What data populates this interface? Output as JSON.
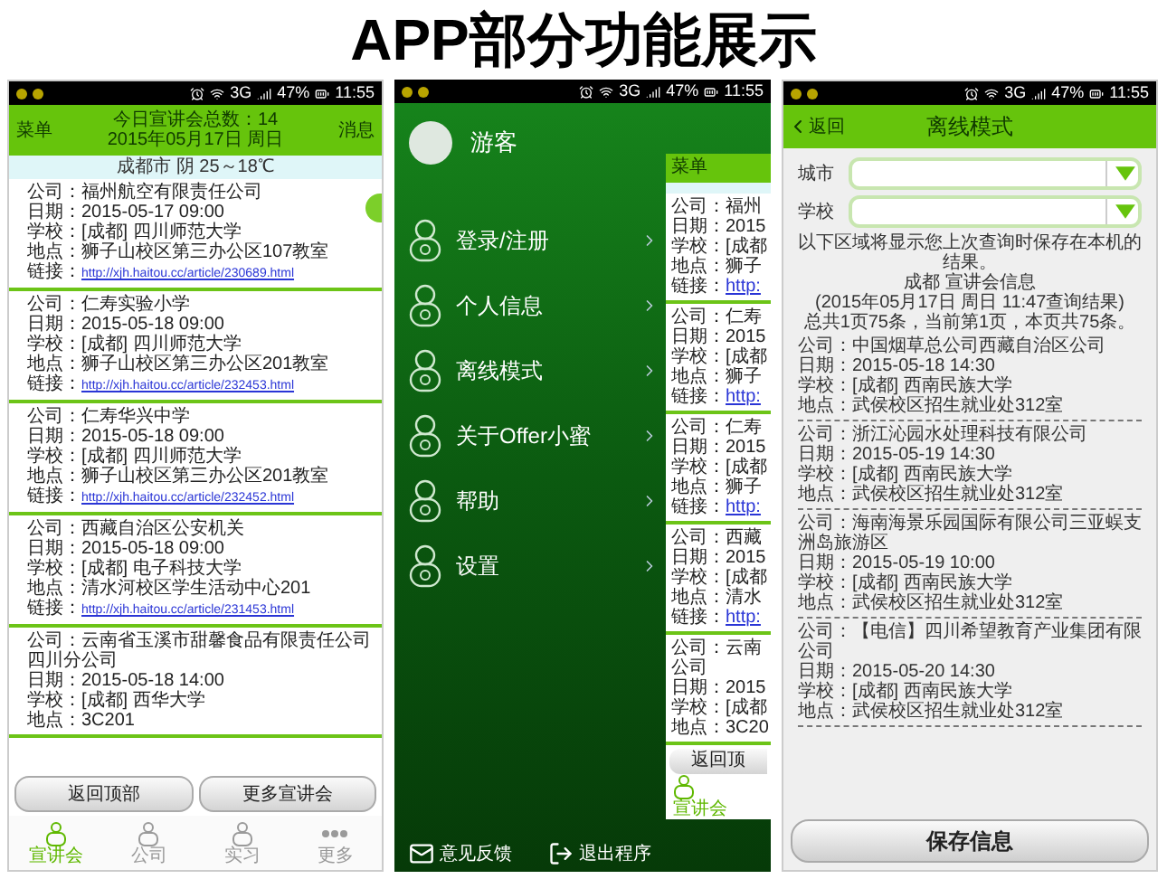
{
  "title": "APP部分功能展示",
  "phones": [
    {
      "kind": "list",
      "status": {
        "network": "3G",
        "battery": "47%",
        "time": "11:55"
      },
      "header": {
        "left": "菜单",
        "lines": [
          "今日宣讲会总数：14",
          "2015年05月17日 周日"
        ],
        "right": "消息"
      },
      "weather": "成都市 阴 25～18℃",
      "cards": [
        {
          "lines": [
            "公司：福州航空有限责任公司",
            "日期：2015-05-17 09:00",
            "学校：[成都] 四川师范大学",
            "地点：狮子山校区第三办公区107教室"
          ],
          "link": {
            "label": "链接：",
            "url": "http://xjh.haitou.cc/article/230689.html"
          }
        },
        {
          "lines": [
            "公司：仁寿实验小学",
            "日期：2015-05-18 09:00",
            "学校：[成都] 四川师范大学",
            "地点：狮子山校区第三办公区201教室"
          ],
          "link": {
            "label": "链接：",
            "url": "http://xjh.haitou.cc/article/232453.html"
          }
        },
        {
          "lines": [
            "公司：仁寿华兴中学",
            "日期：2015-05-18 09:00",
            "学校：[成都] 四川师范大学",
            "地点：狮子山校区第三办公区201教室"
          ],
          "link": {
            "label": "链接：",
            "url": "http://xjh.haitou.cc/article/232452.html"
          }
        },
        {
          "lines": [
            "公司：西藏自治区公安机关",
            "日期：2015-05-18 09:00",
            "学校：[成都] 电子科技大学",
            "地点：清水河校区学生活动中心201"
          ],
          "link": {
            "label": "链接：",
            "url": "http://xjh.haitou.cc/article/231453.html"
          }
        },
        {
          "lines": [
            "公司：云南省玉溪市甜馨食品有限责任公司四川分公司",
            "日期：2015-05-18 14:00",
            "学校：[成都] 西华大学",
            "地点：3C201"
          ]
        }
      ],
      "buttons": [
        "返回顶部",
        "更多宣讲会"
      ],
      "tabs": [
        {
          "label": "宣讲会",
          "selected": true
        },
        {
          "label": "公司",
          "selected": false
        },
        {
          "label": "实习",
          "selected": false
        },
        {
          "label": "更多",
          "selected": false
        }
      ]
    },
    {
      "kind": "menu",
      "status": {
        "network": "3G",
        "battery": "47%",
        "time": "11:55"
      },
      "user": "游客",
      "items": [
        "登录/注册",
        "个人信息",
        "离线模式",
        "关于Offer小蜜",
        "帮助",
        "设置"
      ],
      "footer": [
        "意见反馈",
        "退出程序"
      ],
      "peek": {
        "header": "菜单",
        "cards": [
          {
            "lines": [
              "公司：福州",
              "日期：2015",
              "学校：[成都",
              "地点：狮子"
            ],
            "link": {
              "label": "链接：",
              "url": "http:"
            }
          },
          {
            "lines": [
              "公司：仁寿",
              "日期：2015",
              "学校：[成都",
              "地点：狮子"
            ],
            "link": {
              "label": "链接：",
              "url": "http:"
            }
          },
          {
            "lines": [
              "公司：仁寿",
              "日期：2015",
              "学校：[成都",
              "地点：狮子"
            ],
            "link": {
              "label": "链接：",
              "url": "http:"
            }
          },
          {
            "lines": [
              "公司：西藏",
              "日期：2015",
              "学校：[成都",
              "地点：清水"
            ],
            "link": {
              "label": "链接：",
              "url": "http:"
            }
          },
          {
            "lines": [
              "公司：云南",
              "公司",
              "日期：2015",
              "学校：[成都",
              "地点：3C20"
            ]
          }
        ],
        "button": "返回顶",
        "tab": {
          "label": "宣讲会",
          "selected": true
        }
      }
    },
    {
      "kind": "offline",
      "status": {
        "network": "3G",
        "battery": "47%",
        "time": "11:55"
      },
      "back": "返回",
      "title": "离线模式",
      "fields": [
        {
          "label": "城市"
        },
        {
          "label": "学校"
        }
      ],
      "notes": [
        "以下区域将显示您上次查询时保存在本机的结果。",
        "成都 宣讲会信息",
        "(2015年05月17日 周日 11:47查询结果)",
        "总共1页75条，当前第1页，本页共75条。"
      ],
      "entries": [
        {
          "lines": [
            "公司：中国烟草总公司西藏自治区公司",
            "日期：2015-05-18 14:30",
            "学校：[成都] 西南民族大学",
            "地点：武侯校区招生就业处312室"
          ]
        },
        {
          "lines": [
            "公司：浙江沁园水处理科技有限公司",
            "日期：2015-05-19 14:30",
            "学校：[成都] 西南民族大学",
            "地点：武侯校区招生就业处312室"
          ]
        },
        {
          "lines": [
            "公司：海南海景乐园国际有限公司三亚蜈支洲岛旅游区",
            "日期：2015-05-19 10:00",
            "学校：[成都] 西南民族大学",
            "地点：武侯校区招生就业处312室"
          ]
        },
        {
          "lines": [
            "公司：【电信】四川希望教育产业集团有限公司",
            "日期：2015-05-20 14:30",
            "学校：[成都] 西南民族大学",
            "地点：武侯校区招生就业处312室"
          ]
        }
      ],
      "button": "保存信息"
    }
  ]
}
